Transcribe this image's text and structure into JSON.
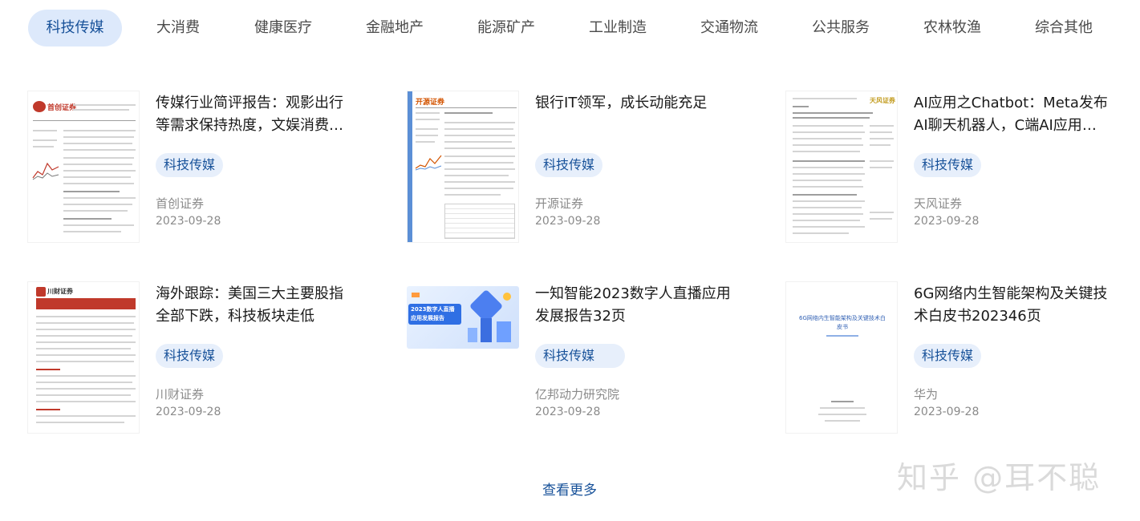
{
  "tabs": [
    {
      "label": "科技传媒",
      "active": true
    },
    {
      "label": "大消费"
    },
    {
      "label": "健康医疗"
    },
    {
      "label": "金融地产"
    },
    {
      "label": "能源矿产"
    },
    {
      "label": "工业制造"
    },
    {
      "label": "交通物流"
    },
    {
      "label": "公共服务"
    },
    {
      "label": "农林牧渔"
    },
    {
      "label": "综合其他"
    }
  ],
  "reports": [
    {
      "title": "传媒行业简评报告：观影出行等需求保持热度，文娱消费…",
      "tag": "科技传媒",
      "source": "首创证券",
      "date": "2023-09-28"
    },
    {
      "title": "银行IT领军，成长动能充足",
      "tag": "科技传媒",
      "source": "开源证券",
      "date": "2023-09-28"
    },
    {
      "title": "AI应用之Chatbot：Meta发布AI聊天机器人，C端AI应用落…",
      "tag": "科技传媒",
      "source": "天风证券",
      "date": "2023-09-28"
    },
    {
      "title": "海外跟踪：美国三大主要股指全部下跌，科技板块走低",
      "tag": "科技传媒",
      "source": "川财证券",
      "date": "2023-09-28"
    },
    {
      "title": "一知智能2023数字人直播应用发展报告32页",
      "tag": "科技传媒",
      "source": "亿邦动力研究院",
      "date": "2023-09-28"
    },
    {
      "title": "6G网络内生智能架构及关键技术白皮书202346页",
      "tag": "科技传媒",
      "source": "华为",
      "date": "2023-09-28"
    }
  ],
  "thumbs": {
    "t1_brand": "首创证券",
    "t2_brand": "开源证券",
    "t3_brand": "天风证券",
    "t4_brand": "川财证券",
    "t5_heading": "2023数字人直播应用发展报告",
    "t6_heading": "6G网络内生智能架构及关键技术白皮书"
  },
  "more_label": "查看更多",
  "watermark": "知乎 @耳不聪",
  "colors": {
    "accent": "#175199",
    "tab_active_bg": "#dde9fb",
    "tag_bg": "#e7effb",
    "meta_text": "#8a8a8a"
  }
}
